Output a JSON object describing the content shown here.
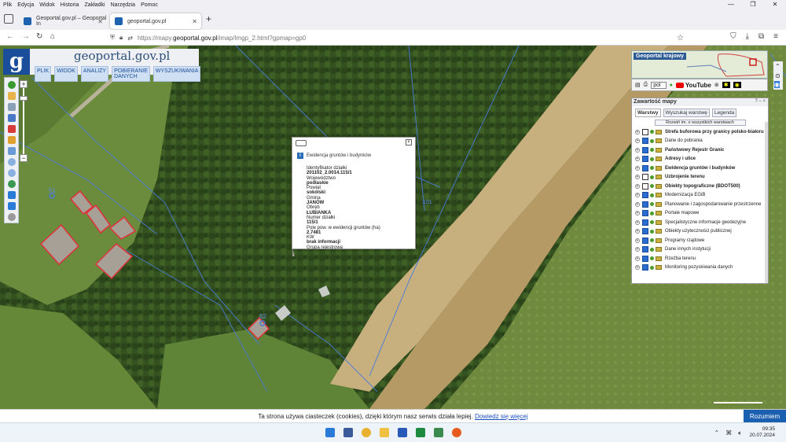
{
  "browser": {
    "menu": [
      "Plik",
      "Edycja",
      "Widok",
      "Historia",
      "Zakładki",
      "Narzędzia",
      "Pomoc"
    ],
    "tabs": [
      {
        "title": "Geoportal.gov.pl – Geoportal In",
        "active": false
      },
      {
        "title": "geoportal.gov.pl",
        "active": true
      }
    ],
    "url_prefix": "https://mapy.",
    "url_domain": "geoportal.gov.pl",
    "url_suffix": "/imap/Imgp_2.html?gpmap=gp0"
  },
  "app": {
    "logo_letter": "g",
    "logo_text": "geoportal.gov.pl",
    "menu": [
      "PLIK",
      "WIDOK",
      "ANALIZY",
      "POBIERANIE DANYCH",
      "WYSZUKIWANIA"
    ]
  },
  "popup": {
    "title": "Ewidencja gruntów i budynków",
    "fields": [
      {
        "label": "Identyfikator działki",
        "value": "201102_2.0014.115/1"
      },
      {
        "label": "Województwo",
        "value": "podlaskie"
      },
      {
        "label": "Powiat",
        "value": "sokólski"
      },
      {
        "label": "Gmina",
        "value": "JANÓW"
      },
      {
        "label": "Obręb",
        "value": "ŁUBIANKA"
      },
      {
        "label": "Numer działki",
        "value": "115/1"
      },
      {
        "label": "Pole pow. w ewidencji gruntów (ha)",
        "value": "2.7481"
      },
      {
        "label": "KW",
        "value": "brak informacji"
      },
      {
        "label": "Grupa rejestrowa",
        "value": ""
      }
    ]
  },
  "map_labels": {
    "l1": "51",
    "l2": "52",
    "l3": "101"
  },
  "minimap": {
    "title": "Geoportal krajowy"
  },
  "toolbar_right": {
    "lang": "pol",
    "youtube": "YouTube"
  },
  "layers_panel": {
    "title": "Zawartość mapy",
    "tabs": [
      "Warstwy",
      "Wyszukaj warstwę",
      "Legenda"
    ],
    "expand_label": "Rozwiń im. o wszystkich warstwach",
    "layers": [
      {
        "name": "Strefa buforowa przy granicy polsko-białoru",
        "checked": false,
        "bold": true
      },
      {
        "name": "Dane do pobrania",
        "checked": true,
        "bold": false
      },
      {
        "name": "Państwowy Rejestr Granic",
        "checked": true,
        "bold": true
      },
      {
        "name": "Adresy i ulice",
        "checked": true,
        "bold": true
      },
      {
        "name": "Ewidencja gruntów i budynków",
        "checked": true,
        "bold": true
      },
      {
        "name": "Uzbrojenie terenu",
        "checked": false,
        "bold": true
      },
      {
        "name": "Obiekty topograficzne (BDOT500)",
        "checked": false,
        "bold": true
      },
      {
        "name": "Modernizacja EGiB",
        "checked": true,
        "bold": false
      },
      {
        "name": "Planowanie i zagospodarowanie przestrzenne",
        "checked": true,
        "bold": false
      },
      {
        "name": "Portale mapowe",
        "checked": true,
        "bold": false
      },
      {
        "name": "Specjalistyczne informacje geodezyjne",
        "checked": true,
        "bold": false
      },
      {
        "name": "Obiekty użyteczności publicznej",
        "checked": true,
        "bold": false
      },
      {
        "name": "Programy rządowe",
        "checked": true,
        "bold": false
      },
      {
        "name": "Dane innych instytucji",
        "checked": true,
        "bold": false
      },
      {
        "name": "Rzeźba terenu",
        "checked": true,
        "bold": false
      },
      {
        "name": "Monitoring pozyskiwania danych",
        "checked": true,
        "bold": false
      }
    ]
  },
  "cookie": {
    "text": "Ta strona używa ciasteczek (cookies), dzięki którym nasz serwis działa lepiej. ",
    "link": "Dowiedz się więcej",
    "button": "Rozumiem"
  },
  "taskbar": {
    "time": "09:35",
    "date": "20.07.2024"
  },
  "colors": {
    "accent": "#1a4e9a",
    "parcel": "#e0303a",
    "boundary": "#4a7ad8"
  }
}
